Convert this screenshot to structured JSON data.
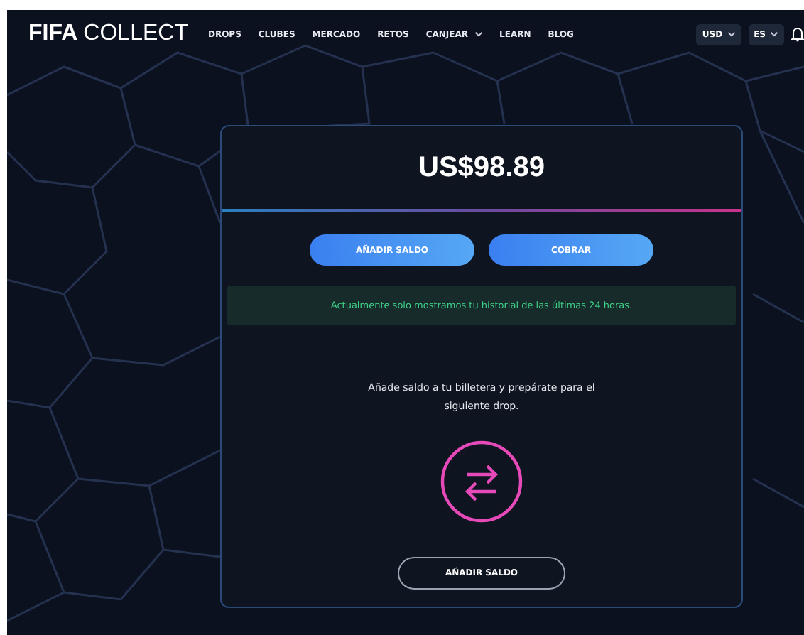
{
  "header": {
    "logo": {
      "bold": "FIFA",
      "light": "COLLECT"
    },
    "nav": [
      {
        "label": "DROPS",
        "kind": "link"
      },
      {
        "label": "CLUBES",
        "kind": "link"
      },
      {
        "label": "MERCADO",
        "kind": "link"
      },
      {
        "label": "RETOS",
        "kind": "link"
      },
      {
        "label": "CANJEAR",
        "kind": "dropdown"
      },
      {
        "label": "LEARN",
        "kind": "link"
      },
      {
        "label": "BLOG",
        "kind": "link"
      }
    ],
    "currency": "USD",
    "language": "ES"
  },
  "wallet": {
    "balance": "US$98.89",
    "actions": [
      {
        "label": "AÑADIR SALDO"
      },
      {
        "label": "COBRAR"
      }
    ],
    "notice": "Actualmente solo mostramos tu historial de las últimas 24 horas.",
    "empty_message": "Añade saldo a tu billetera y prepárate para el siguiente drop.",
    "cta": "AÑADIR SALDO"
  }
}
